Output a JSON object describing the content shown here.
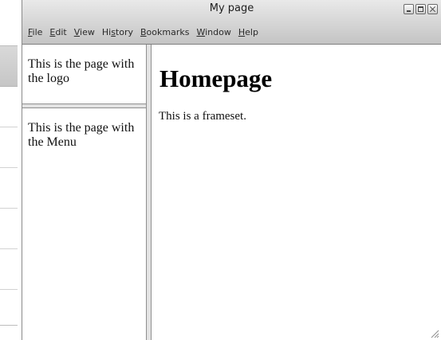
{
  "window": {
    "title": "My page"
  },
  "menu": [
    {
      "label": "File",
      "mnemonic": "F",
      "rest": "ile"
    },
    {
      "label": "Edit",
      "mnemonic": "E",
      "rest": "dit"
    },
    {
      "label": "View",
      "mnemonic": "V",
      "rest": "iew"
    },
    {
      "label": "History",
      "mnemonic": "",
      "pre": "Hi",
      "u": "s",
      "post": "tory"
    },
    {
      "label": "Bookmarks",
      "mnemonic": "B",
      "rest": "ookmarks"
    },
    {
      "label": "Window",
      "mnemonic": "W",
      "rest": "indow"
    },
    {
      "label": "Help",
      "mnemonic": "H",
      "rest": "elp"
    }
  ],
  "frames": {
    "logo_text": "This is the page with the logo",
    "menu_text": "This is the page with the Menu",
    "main_heading": "Homepage",
    "main_paragraph": "This is a frameset."
  },
  "icons": {
    "minimize": "minimize-icon",
    "maximize": "maximize-icon",
    "close": "close-icon",
    "resize": "resize-grip-icon"
  }
}
